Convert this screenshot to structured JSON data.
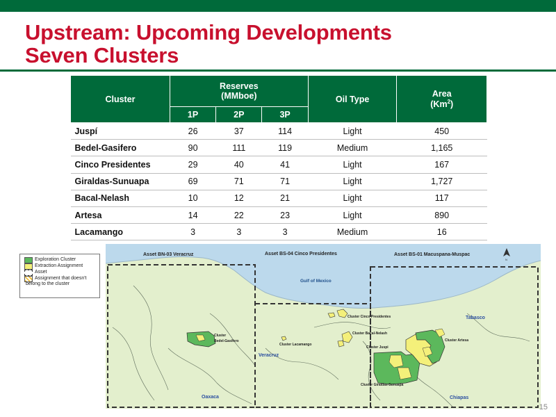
{
  "title": {
    "line1": "Upstream: Upcoming Developments",
    "line2": "Seven Clusters"
  },
  "table": {
    "headers": {
      "cluster": "Cluster",
      "reserves": "Reserves",
      "reserves_unit": "(MMboe)",
      "p1": "1P",
      "p2": "2P",
      "p3": "3P",
      "oil_type": "Oil Type",
      "area": "Area",
      "area_unit_prefix": "(Km",
      "area_unit_sup": "2",
      "area_unit_suffix": ")"
    },
    "rows": [
      {
        "cluster": "Juspí",
        "p1": "26",
        "p2": "37",
        "p3": "114",
        "oil": "Light",
        "area": "450"
      },
      {
        "cluster": "Bedel-Gasifero",
        "p1": "90",
        "p2": "111",
        "p3": "119",
        "oil": "Medium",
        "area": "1,165"
      },
      {
        "cluster": "Cinco Presidentes",
        "p1": "29",
        "p2": "40",
        "p3": "41",
        "oil": "Light",
        "area": "167"
      },
      {
        "cluster": "Giraldas-Sunuapa",
        "p1": "69",
        "p2": "71",
        "p3": "71",
        "oil": "Light",
        "area": "1,727"
      },
      {
        "cluster": "Bacal-Nelash",
        "p1": "10",
        "p2": "12",
        "p3": "21",
        "oil": "Light",
        "area": "117"
      },
      {
        "cluster": "Artesa",
        "p1": "14",
        "p2": "22",
        "p3": "23",
        "oil": "Light",
        "area": "890"
      },
      {
        "cluster": "Lacamango",
        "p1": "3",
        "p2": "3",
        "p3": "3",
        "oil": "Medium",
        "area": "16"
      }
    ]
  },
  "legend": {
    "exploration": "Exploration Cluster",
    "extraction": "Extraction Assignment",
    "asset": "Asset",
    "not_belong_1": "Assignment that doesn't",
    "not_belong_2": "belong to the cluster"
  },
  "map": {
    "asset_bn03": "Asset BN-03 Veracruz",
    "asset_bs04": "Asset BS-04 Cinco Presidentes",
    "asset_bs01": "Asset BS-01 Macuspana-Muspac",
    "gulf": "Gulf of Mexico",
    "tabasco": "Tabasco",
    "veracruz": "Veracruz",
    "oaxaca": "Oaxaca",
    "chiapas": "Chiapas",
    "cluster_word": "Cluster",
    "bedel": "Bedel-Gasifero",
    "lacamango": "Cluster Lacamango",
    "cinco": "Cluster Cinco Presidentes",
    "bacal": "Cluster Bacal-Nelash",
    "juspi": "Cluster Juspi",
    "artesa": "Cluster Artesa",
    "giraldas": "Cluster Giraldas-Sunuapa",
    "north": "N"
  },
  "colors": {
    "brand_green": "#006a3a",
    "title_red": "#c8102e",
    "land": "#e3efcd",
    "sea": "#bcd9ec",
    "cluster_green": "#5cb85c",
    "cluster_yellow": "#f4f07a"
  },
  "page_number": "15"
}
